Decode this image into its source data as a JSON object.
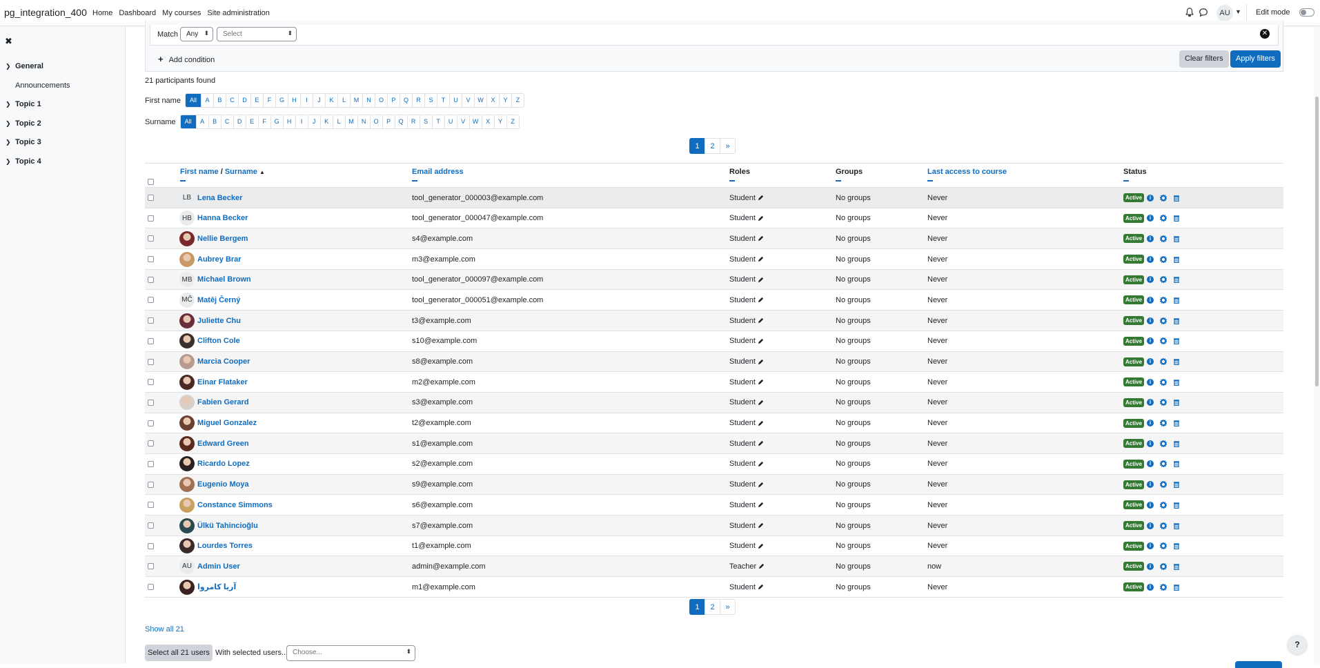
{
  "navbar": {
    "site_name": "pg_integration_400",
    "links": [
      "Home",
      "Dashboard",
      "My courses",
      "Site administration"
    ],
    "user_initials": "AU",
    "edit_mode_label": "Edit mode"
  },
  "sidebar": {
    "sections": [
      {
        "label": "General",
        "children": [
          "Announcements"
        ]
      },
      {
        "label": "Topic 1"
      },
      {
        "label": "Topic 2"
      },
      {
        "label": "Topic 3"
      },
      {
        "label": "Topic 4"
      }
    ]
  },
  "filters": {
    "match_label": "Match",
    "match_value": "Any",
    "select_placeholder": "Select",
    "add_condition": "Add condition",
    "clear_filters": "Clear filters",
    "apply_filters": "Apply filters"
  },
  "participants_found": "21 participants found",
  "initials": {
    "first_name_label": "First name",
    "surname_label": "Surname",
    "all_label": "All",
    "letters": [
      "A",
      "B",
      "C",
      "D",
      "E",
      "F",
      "G",
      "H",
      "I",
      "J",
      "K",
      "L",
      "M",
      "N",
      "O",
      "P",
      "Q",
      "R",
      "S",
      "T",
      "U",
      "V",
      "W",
      "X",
      "Y",
      "Z"
    ]
  },
  "pagination": {
    "pages": [
      "1",
      "2"
    ],
    "next": "»",
    "current": "1"
  },
  "table": {
    "headers": {
      "first_name": "First name",
      "separator": " / ",
      "surname": "Surname",
      "email": "Email address",
      "roles": "Roles",
      "groups": "Groups",
      "last_access": "Last access to course",
      "status": "Status"
    },
    "rows": [
      {
        "initials": "LB",
        "photo": false,
        "name": "Lena Becker",
        "email": "tool_generator_000003@example.com",
        "role": "Student",
        "groups": "No groups",
        "last_access": "Never",
        "status": "Active"
      },
      {
        "initials": "HB",
        "photo": false,
        "name": "Hanna Becker",
        "email": "tool_generator_000047@example.com",
        "role": "Student",
        "groups": "No groups",
        "last_access": "Never",
        "status": "Active"
      },
      {
        "initials": "",
        "photo": true,
        "color": "#7a2a2a",
        "name": "Nellie Bergem",
        "email": "s4@example.com",
        "role": "Student",
        "groups": "No groups",
        "last_access": "Never",
        "status": "Active"
      },
      {
        "initials": "",
        "photo": true,
        "color": "#c89a6a",
        "name": "Aubrey Brar",
        "email": "m3@example.com",
        "role": "Student",
        "groups": "No groups",
        "last_access": "Never",
        "status": "Active"
      },
      {
        "initials": "MB",
        "photo": false,
        "name": "Michael Brown",
        "email": "tool_generator_000097@example.com",
        "role": "Student",
        "groups": "No groups",
        "last_access": "Never",
        "status": "Active"
      },
      {
        "initials": "MČ",
        "photo": false,
        "name": "Matěj Černý",
        "email": "tool_generator_000051@example.com",
        "role": "Student",
        "groups": "No groups",
        "last_access": "Never",
        "status": "Active"
      },
      {
        "initials": "",
        "photo": true,
        "color": "#6b2d3a",
        "name": "Juliette Chu",
        "email": "t3@example.com",
        "role": "Student",
        "groups": "No groups",
        "last_access": "Never",
        "status": "Active"
      },
      {
        "initials": "",
        "photo": true,
        "color": "#3a3030",
        "name": "Clifton Cole",
        "email": "s10@example.com",
        "role": "Student",
        "groups": "No groups",
        "last_access": "Never",
        "status": "Active"
      },
      {
        "initials": "",
        "photo": true,
        "color": "#b89a90",
        "name": "Marcia Cooper",
        "email": "s8@example.com",
        "role": "Student",
        "groups": "No groups",
        "last_access": "Never",
        "status": "Active"
      },
      {
        "initials": "",
        "photo": true,
        "color": "#4a2a22",
        "name": "Einar Flataker",
        "email": "m2@example.com",
        "role": "Student",
        "groups": "No groups",
        "last_access": "Never",
        "status": "Active"
      },
      {
        "initials": "",
        "photo": true,
        "color": "#d8cfc8",
        "name": "Fabien Gerard",
        "email": "s3@example.com",
        "role": "Student",
        "groups": "No groups",
        "last_access": "Never",
        "status": "Active"
      },
      {
        "initials": "",
        "photo": true,
        "color": "#6a4030",
        "name": "Miguel Gonzalez",
        "email": "t2@example.com",
        "role": "Student",
        "groups": "No groups",
        "last_access": "Never",
        "status": "Active"
      },
      {
        "initials": "",
        "photo": true,
        "color": "#5a2a20",
        "name": "Edward Green",
        "email": "s1@example.com",
        "role": "Student",
        "groups": "No groups",
        "last_access": "Never",
        "status": "Active"
      },
      {
        "initials": "",
        "photo": true,
        "color": "#2a2222",
        "name": "Ricardo Lopez",
        "email": "s2@example.com",
        "role": "Student",
        "groups": "No groups",
        "last_access": "Never",
        "status": "Active"
      },
      {
        "initials": "",
        "photo": true,
        "color": "#a07050",
        "name": "Eugenio Moya",
        "email": "s9@example.com",
        "role": "Student",
        "groups": "No groups",
        "last_access": "Never",
        "status": "Active"
      },
      {
        "initials": "",
        "photo": true,
        "color": "#c8a060",
        "name": "Constance Simmons",
        "email": "s6@example.com",
        "role": "Student",
        "groups": "No groups",
        "last_access": "Never",
        "status": "Active"
      },
      {
        "initials": "",
        "photo": true,
        "color": "#2a4a50",
        "name": "Ülkü Tahincioğlu",
        "email": "s7@example.com",
        "role": "Student",
        "groups": "No groups",
        "last_access": "Never",
        "status": "Active"
      },
      {
        "initials": "",
        "photo": true,
        "color": "#3a2a2a",
        "name": "Lourdes Torres",
        "email": "t1@example.com",
        "role": "Student",
        "groups": "No groups",
        "last_access": "Never",
        "status": "Active"
      },
      {
        "initials": "AU",
        "photo": false,
        "name": "Admin User",
        "email": "admin@example.com",
        "role": "Teacher",
        "groups": "No groups",
        "last_access": "now",
        "status": "Active"
      },
      {
        "initials": "",
        "photo": true,
        "color": "#3a2222",
        "name": "آریا کامروا",
        "email": "m1@example.com",
        "role": "Student",
        "groups": "No groups",
        "last_access": "Never",
        "status": "Active"
      }
    ]
  },
  "footer": {
    "show_all": "Show all 21",
    "select_all": "Select all 21 users",
    "with_selected": "With selected users...",
    "choose_placeholder": "Choose..."
  },
  "help_label": "?"
}
